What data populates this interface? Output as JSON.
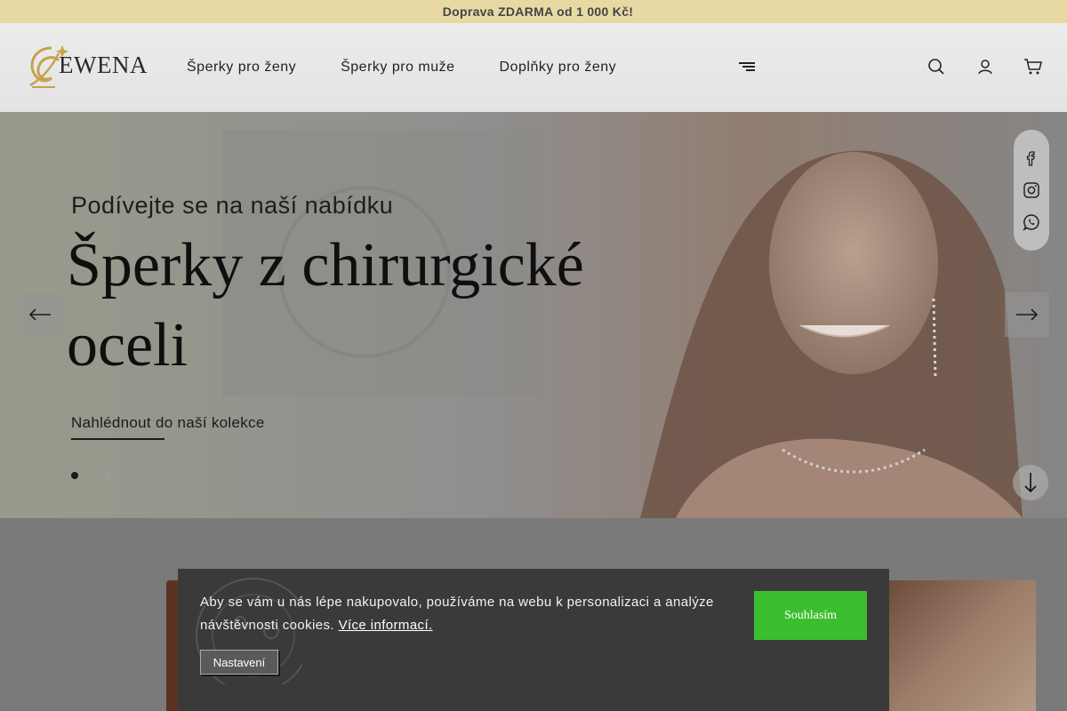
{
  "topbar": {
    "glyph": "",
    "text": "Doprava ZDARMA od 1 000 Kč!"
  },
  "header": {
    "logo_text": "EWENA",
    "nav": [
      {
        "label": "Šperky pro ženy",
        "caret": ""
      },
      {
        "label": "Šperky pro muže",
        "caret": ""
      },
      {
        "label": "Doplňky pro ženy",
        "caret": ""
      }
    ],
    "misc_glyph": "",
    "icons": [
      "menu-icon",
      "search-icon",
      "user-icon",
      "cart-icon"
    ]
  },
  "hero": {
    "subtitle": "Podívejte se na naší nabídku",
    "title": "Šperky z chirurgické oceli",
    "link": "Nahlédnout do naší kolekce",
    "slide_count": 2,
    "active_slide": 1,
    "social": [
      "facebook-icon",
      "instagram-icon",
      "whatsapp-icon"
    ]
  },
  "cookie": {
    "text": "Aby se vám u nás lépe nakupovalo, používáme na webu k personalizaci a analýze návštěvnosti cookies.",
    "link": "Více informací.",
    "settings_label": "Nastavení",
    "accept_label": "Souhlasím"
  },
  "colors": {
    "topbar": "#e8d9a4",
    "accept": "#3cbf2e",
    "cookie_bg": "#3a3a3a"
  }
}
